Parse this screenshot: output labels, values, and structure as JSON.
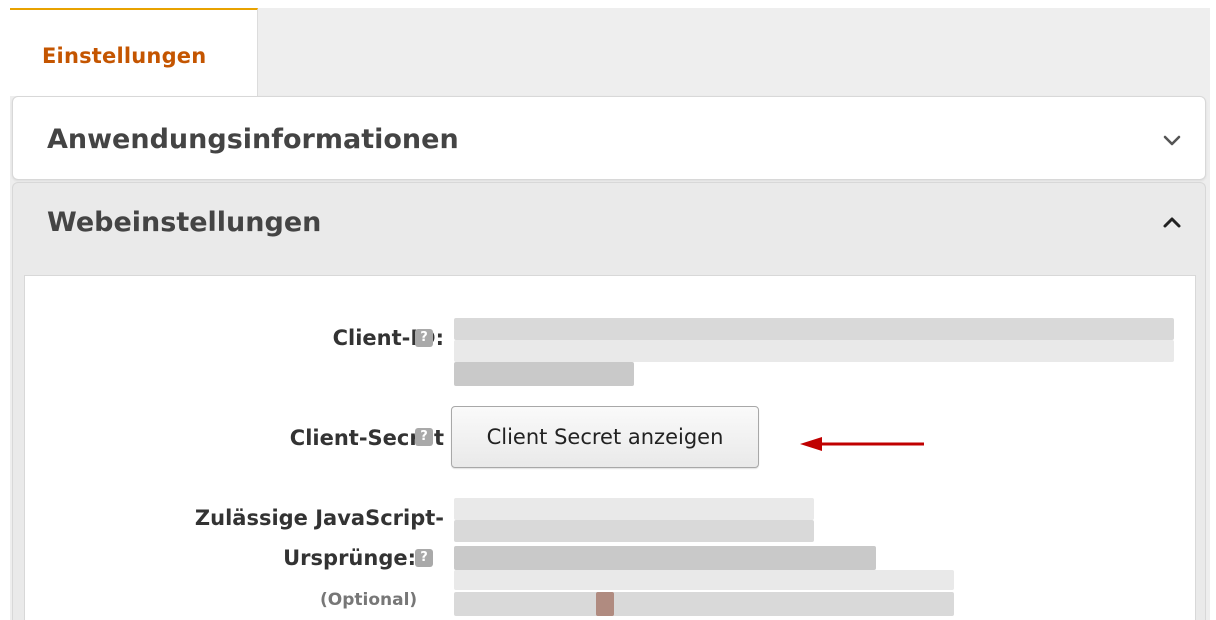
{
  "tabs": [
    {
      "label": "Einstellungen",
      "active": true
    }
  ],
  "panels": {
    "app_info": {
      "title": "Anwendungsinformationen",
      "expanded": false,
      "chevron": "chevron-down-icon"
    },
    "web_settings": {
      "title": "Webeinstellungen",
      "expanded": true,
      "chevron": "chevron-up-icon"
    }
  },
  "fields": {
    "client_id": {
      "label": "Client-ID:",
      "help_icon": "help-icon"
    },
    "client_secret": {
      "label": "Client-Secret",
      "button_label": "Client Secret anzeigen",
      "help_icon": "help-icon"
    },
    "js_origins": {
      "label_line1": "Zulässige JavaScript-",
      "label_line2": "Ursprünge:",
      "optional": "(Optional)",
      "help_icon": "help-icon"
    }
  },
  "colors": {
    "accent": "#e8a200",
    "tab_text": "#c45500",
    "arrow": "#c00000"
  }
}
